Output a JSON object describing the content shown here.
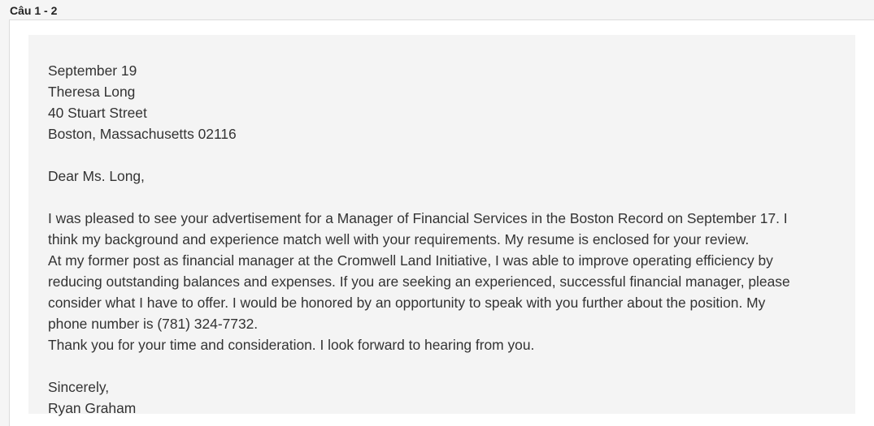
{
  "question": {
    "label": "Câu 1 - 2"
  },
  "letter": {
    "date": "September 19",
    "recipient_name": "Theresa Long",
    "recipient_street": "40 Stuart Street",
    "recipient_city": "Boston, Massachusetts 02116",
    "salutation": "Dear Ms. Long,",
    "body_lines": [
      "I was pleased to see your advertisement for a Manager of Financial Services in the Boston Record on September 17. I",
      "think my background and experience match well with your requirements. My resume is enclosed for your review.",
      "At my former post as financial manager at the Cromwell Land Initiative, I was able to improve operating efficiency by",
      "reducing outstanding balances and expenses. If you are seeking an experienced, successful financial manager, please",
      "consider what I have to offer. I would be honored by an opportunity to speak with you further about the position. My",
      "phone number is (781) 324-7732.",
      "Thank you for your time and consideration. I look forward to hearing from you."
    ],
    "closing": "Sincerely,",
    "signature": "Ryan Graham"
  }
}
